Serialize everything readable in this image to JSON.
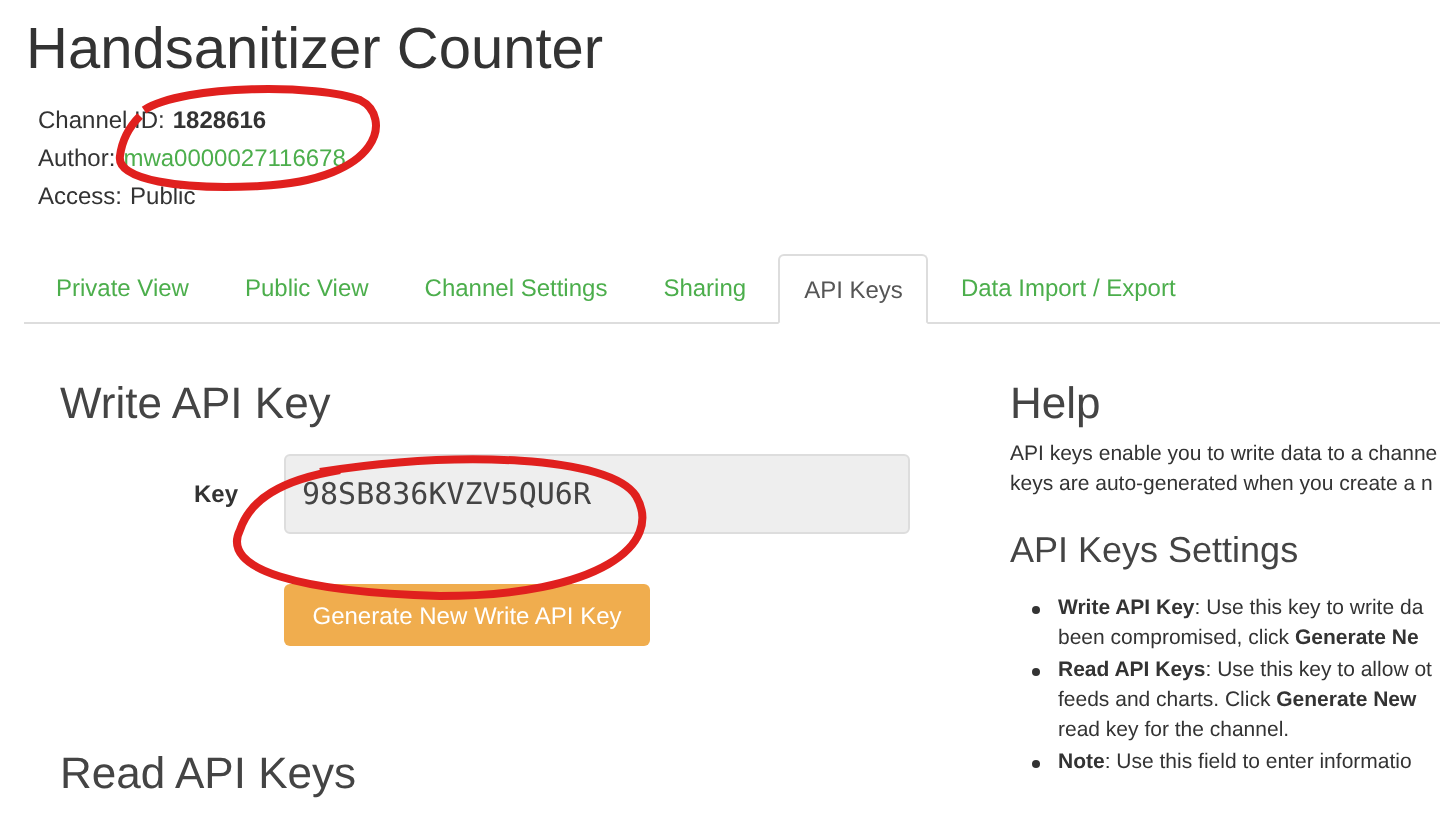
{
  "title": "Handsanitizer Counter",
  "info": [
    {
      "label": "Channel ID:",
      "value": "1828616",
      "kind": "bold"
    },
    {
      "label": "Author:",
      "value": "mwa0000027116678",
      "kind": "link"
    },
    {
      "label": "Access:",
      "value": "Public",
      "kind": "plain"
    }
  ],
  "tabs": [
    {
      "label": "Private View",
      "selected": false
    },
    {
      "label": "Public View",
      "selected": false
    },
    {
      "label": "Channel Settings",
      "selected": false
    },
    {
      "label": "Sharing",
      "selected": false
    },
    {
      "label": "API Keys",
      "selected": true
    },
    {
      "label": "Data Import / Export",
      "selected": false
    }
  ],
  "write_key": {
    "heading": "Write API Key",
    "label": "Key",
    "value": "98SB836KVZV5QU6R",
    "button": "Generate New Write API Key"
  },
  "read_heading": "Read API Keys",
  "help": {
    "heading": "Help",
    "paragraph": [
      "API keys enable you to write data to a channe",
      "keys are auto-generated when you create a n"
    ],
    "subheading": "API Keys Settings",
    "bullets": [
      [
        "**Write API Key**: Use this key to write da",
        "been compromised, click **Generate Ne**"
      ],
      [
        "**Read API Keys**: Use this key to allow ot",
        "feeds and charts. Click **Generate New**",
        "read key for the channel."
      ],
      [
        "**Note**: Use this field to enter informatio"
      ]
    ]
  }
}
